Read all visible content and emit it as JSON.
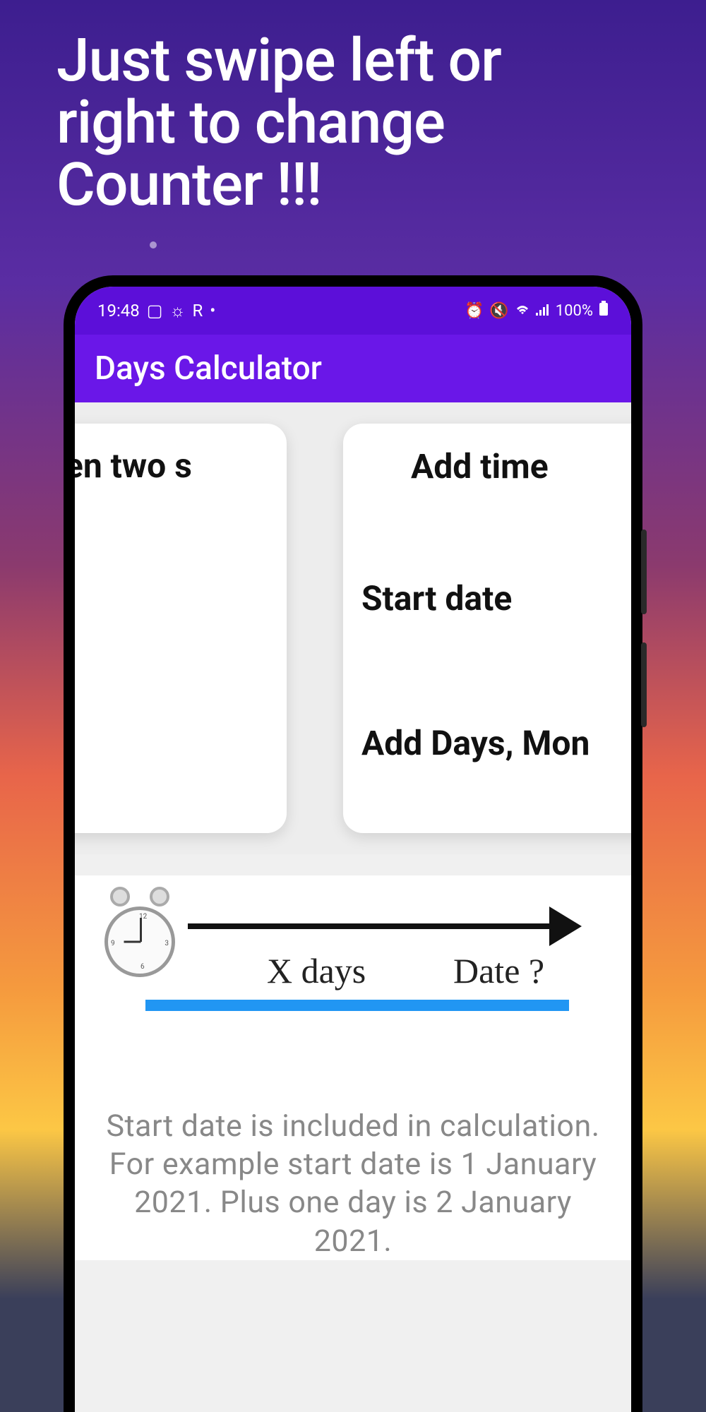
{
  "headline": "Just swipe left or\nright to change\nCounter !!!",
  "statusBar": {
    "time": "19:48",
    "battery": "100%"
  },
  "appBar": {
    "title": "Days Calculator"
  },
  "cards": {
    "leftFragment": "een two s",
    "rightTitle": "Add time",
    "startDate": "Start date",
    "addDays": "Add Days, Mon"
  },
  "illustration": {
    "xDays": "X days",
    "dateQ": "Date ?"
  },
  "description": "Start date is included in calculation. For example start date is 1 January 2021. Plus one day is 2 January 2021."
}
